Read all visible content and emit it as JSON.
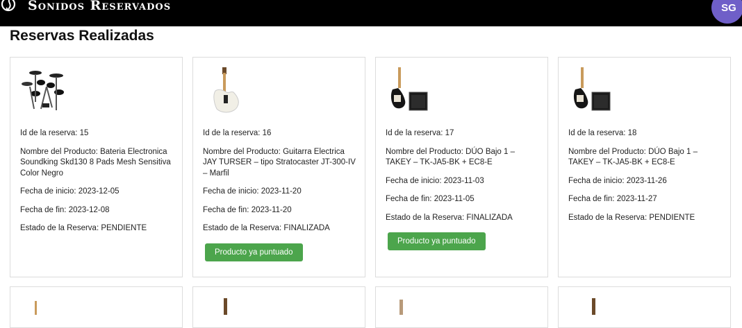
{
  "header": {
    "brand": "Sonidos Reservados",
    "avatar_initials": "SG"
  },
  "page_title": "Reservas Realizadas",
  "labels": {
    "id": "Id de la reserva: ",
    "product": "Nombre del Producto: ",
    "start": "Fecha de inicio: ",
    "end": "Fecha de fin: ",
    "status": "Estado de la Reserva: ",
    "rated_button": "Producto ya puntuado"
  },
  "reservations": [
    {
      "id": "15",
      "product": "Bateria Electronica Soundking Skd130 8 Pads Mesh Sensitiva Color Negro",
      "start": "2023-12-05",
      "end": "2023-12-08",
      "status": "PENDIENTE",
      "rated": false,
      "image_icon": "drum-kit-icon"
    },
    {
      "id": "16",
      "product": "Guitarra Electrica JAY TURSER – tipo Stratocaster JT-300-IV – Marfil",
      "start": "2023-11-20",
      "end": "2023-11-20",
      "status": "FINALIZADA",
      "rated": true,
      "image_icon": "electric-guitar-icon"
    },
    {
      "id": "17",
      "product": "DÚO Bajo 1 – TAKEY – TK-JA5-BK + EC8-E",
      "start": "2023-11-03",
      "end": "2023-11-05",
      "status": "FINALIZADA",
      "rated": true,
      "image_icon": "bass-amp-icon"
    },
    {
      "id": "18",
      "product": "DÚO Bajo 1 – TAKEY – TK-JA5-BK + EC8-E",
      "start": "2023-11-26",
      "end": "2023-11-27",
      "status": "PENDIENTE",
      "rated": false,
      "image_icon": "bass-amp-icon"
    }
  ],
  "colors": {
    "topbar": "#000000",
    "avatar": "#6f5fc8",
    "button": "#4ca54c"
  }
}
